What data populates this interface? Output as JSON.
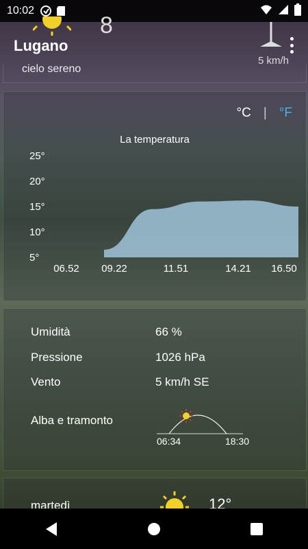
{
  "status": {
    "time": "10:02"
  },
  "header": {
    "city": "Lugano",
    "sky": "cielo sereno",
    "wind": "5 km/h",
    "big_digit": "8"
  },
  "units": {
    "celsius": "°C",
    "separator": "|",
    "fahrenheit": "°F"
  },
  "chart_data": {
    "type": "area",
    "title": "La temperatura",
    "xlabel": "",
    "ylabel": "",
    "x": [
      "06.52",
      "09.22",
      "11.51",
      "14.21",
      "16.50"
    ],
    "series": [
      {
        "values": [
          6.5,
          14.5,
          16,
          16.2,
          15
        ]
      }
    ],
    "y_ticks": [
      "25°",
      "20°",
      "15°",
      "10°",
      "5°"
    ],
    "ylim": [
      5,
      25
    ],
    "grid": false,
    "color": "#a9cfe8"
  },
  "details": {
    "humidity_label": "Umidità",
    "humidity_value": "66 %",
    "pressure_label": "Pressione",
    "pressure_value": "1026 hPa",
    "wind_label": "Vento",
    "wind_value": "5 km/h SE",
    "sun_label": "Alba e tramonto",
    "sunrise": "06:34",
    "sunset": "18:30"
  },
  "forecast": {
    "day": "martedì",
    "temp": "12°"
  }
}
